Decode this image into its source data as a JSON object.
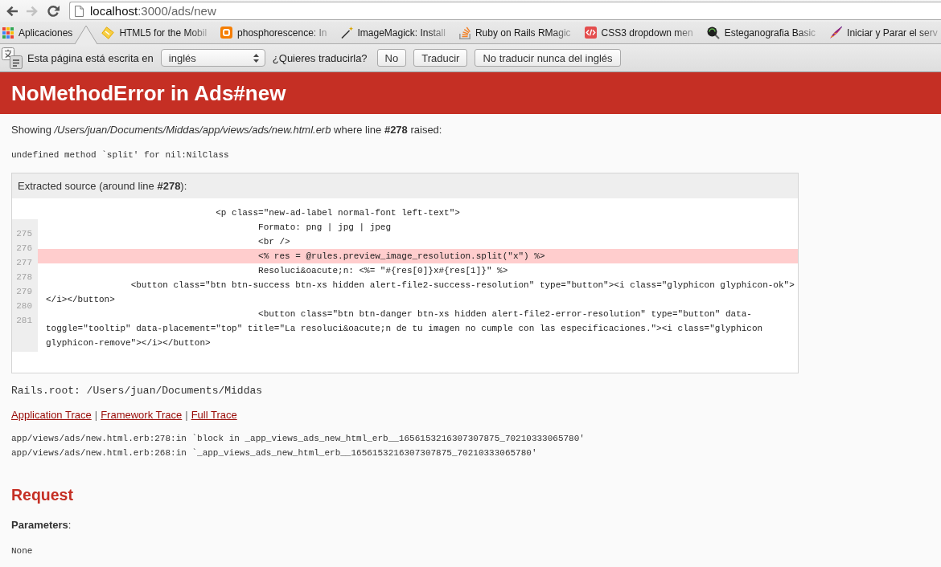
{
  "browser": {
    "nav_buttons": [
      {
        "kind": "back",
        "disabled": false
      },
      {
        "kind": "forward",
        "disabled": true
      },
      {
        "kind": "reload",
        "disabled": false
      }
    ],
    "address": {
      "host": "localhost",
      "path": ":3000/ads/new"
    },
    "bookmarks": [
      {
        "kind": "apps",
        "label": "Aplicaciones"
      },
      {
        "kind": "tile",
        "label": "HTML5 for the Mobil"
      },
      {
        "kind": "blog",
        "label": "phosphorescence: In"
      },
      {
        "kind": "wand",
        "label": "ImageMagick: Install"
      },
      {
        "kind": "stack",
        "label": "Ruby on Rails RMagic"
      },
      {
        "kind": "code",
        "label": "CSS3 dropdown men"
      },
      {
        "kind": "magnifier",
        "label": "Esteganografia Basic"
      },
      {
        "kind": "feather",
        "label": "Iniciar y Parar el serv"
      }
    ],
    "translate_bar": {
      "message": "Esta página está escrita en",
      "language": "inglés",
      "question": "¿Quieres traducirla?",
      "buttons": [
        "No",
        "Traducir",
        "No traducir nunca del inglés"
      ]
    }
  },
  "page": {
    "title": "NoMethodError in Ads#new",
    "showing": "Showing */Users/juan/Documents/Middas/app/views/ads/new.html.erb* where line **#278** raised:",
    "message": "undefined method `split' for nil:NilClass",
    "source": {
      "title": "Extracted source (around line **#278**):",
      "line_numbers": [
        "275",
        "276",
        "277",
        "278",
        "279",
        "280",
        "281"
      ],
      "lines": [
        {
          "text": "                                <p class=\"new-ad-label normal-font left-text\">",
          "highlighted": false
        },
        {
          "text": "                                        Formato: png | jpg | jpeg",
          "highlighted": false
        },
        {
          "text": "                                        <br />",
          "highlighted": false
        },
        {
          "text": "                                        <% res = @rules.preview_image_resolution.split(\"x\") %>",
          "highlighted": true
        },
        {
          "text": "                                        Resoluci&oacute;n: <%= \"#{res[0]}x#{res[1]}\" %>",
          "highlighted": false
        },
        {
          "text": "                <button class=\"btn btn-success btn-xs hidden alert-file2-success-resolution\" type=\"button\"><i class=\"glyphicon glyphicon-ok\">",
          "highlighted": false
        },
        {
          "text": "</i></button>",
          "highlighted": false
        },
        {
          "text": "                                        <button class=\"btn btn-danger btn-xs hidden alert-file2-error-resolution\" type=\"button\" data-",
          "highlighted": false
        },
        {
          "text": "toggle=\"tooltip\" data-placement=\"top\" title=\"La resoluci&oacute;n de tu imagen no cumple con las especificaciones.\"><i class=\"glyphicon",
          "highlighted": false
        },
        {
          "text": "glyphicon-remove\"></i></button>",
          "highlighted": false
        }
      ]
    },
    "rails_root": "Rails.root: /Users/juan/Documents/Middas",
    "trace_links": [
      {
        "kind": "link",
        "label": "Application Trace"
      },
      {
        "kind": "separator",
        "label": "|"
      },
      {
        "kind": "link",
        "label": "Framework Trace"
      },
      {
        "kind": "separator",
        "label": "|"
      },
      {
        "kind": "link",
        "label": "Full Trace"
      }
    ],
    "trace": [
      "app/views/ads/new.html.erb:278:in `block in _app_views_ads_new_html_erb__1656153216307307875_70210333065780'",
      "app/views/ads/new.html.erb:268:in `_app_views_ads_new_html_erb__1656153216307307875_70210333065780'"
    ],
    "request": {
      "heading": "Request",
      "parameters_label": "**Parameters**:",
      "parameters": "None"
    }
  }
}
